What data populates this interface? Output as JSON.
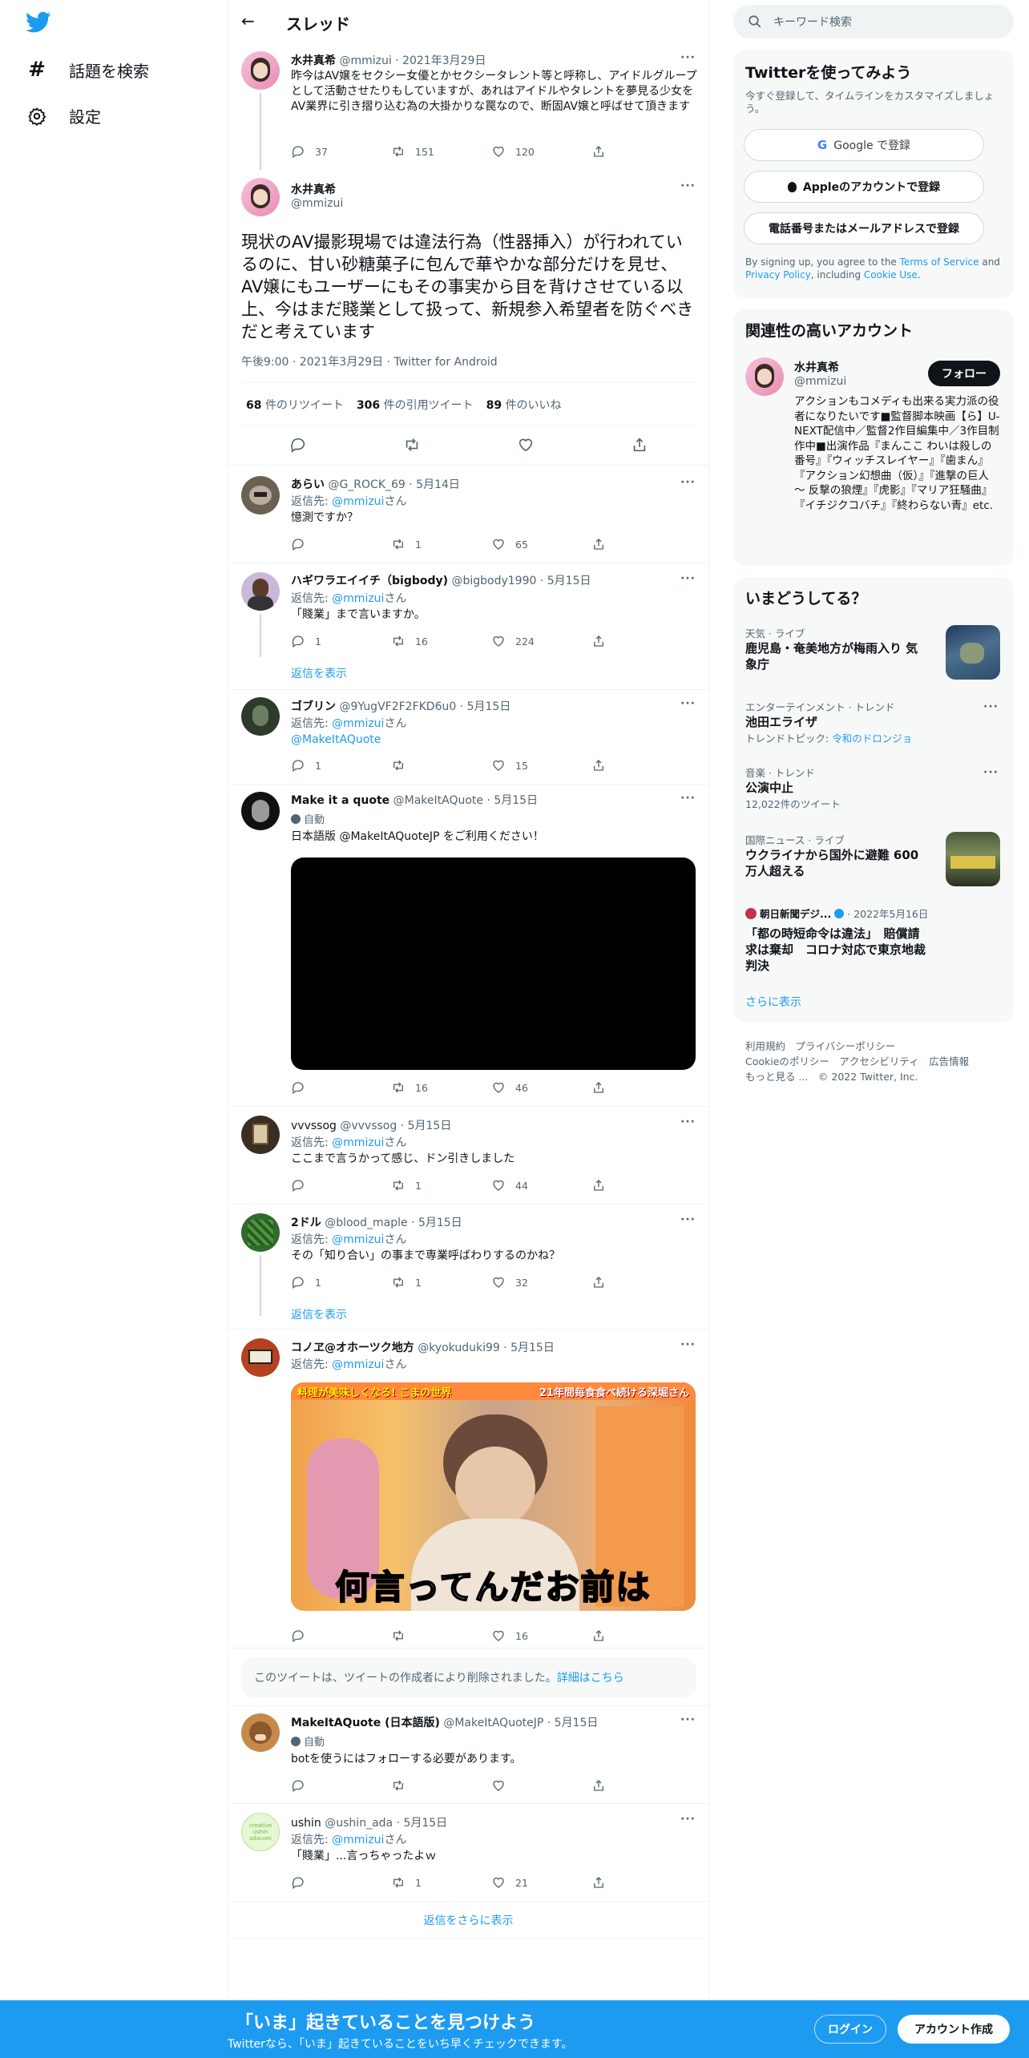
{
  "nav": {
    "items": [
      {
        "label": "話題を検索",
        "icon": "hashtag-icon"
      },
      {
        "label": "設定",
        "icon": "gear-icon"
      }
    ]
  },
  "header": {
    "title": "スレッド"
  },
  "tweets": {
    "prev": {
      "name": "水井真希",
      "handle": "@mmizui",
      "date": "· 2021年3月29日",
      "text": "昨今はAV嬢をセクシー女優とかセクシータレント等と呼称し、アイドルグループとして活動させたりもしていますが、あれはアイドルやタレントを夢見る少女をAV業界に引き摺り込む為の大掛かりな罠なので、断固AV嬢と呼ばせて頂きます",
      "reply": "37",
      "rt": "151",
      "like": "120"
    },
    "main": {
      "name": "水井真希",
      "handle": "@mmizui",
      "text": "現状のAV撮影現場では違法行為（性器挿入）が行われているのに、甘い砂糖菓子に包んで華やかな部分だけを見せ、AV嬢にもユーザーにもその事実から目を背けさせている以上、今はまだ賤業として扱って、新規参入希望者を防ぐべきだと考えています",
      "meta": "午後9:00 · 2021年3月29日 · Twitter for Android",
      "rt_count": "68",
      "rt_label": "件のリツイート",
      "qt_count": "306",
      "qt_label": "件の引用ツイート",
      "like_count": "89",
      "like_label": "件のいいね"
    },
    "r1": {
      "name": "あらい",
      "handle": "@G_ROCK_69 · 5月14日",
      "reply_to": "返信先: ",
      "mention": "@mmizui",
      "san": "さん",
      "text": "憶測ですか？",
      "reply": "",
      "rt": "1",
      "like": "65"
    },
    "r2": {
      "name": "ハギワラエイイチ（bigbody)",
      "handle": "@bigbody1990 · 5月15日",
      "reply_to": "返信先: ",
      "mention": "@mmizui",
      "san": "さん",
      "text": "「賤業」まで言いますか。",
      "reply": "1",
      "rt": "16",
      "like": "224",
      "show": "返信を表示"
    },
    "r3": {
      "name": "ゴブリン",
      "handle": "@9YugVF2F2FKD6u0 · 5月15日",
      "reply_to": "返信先: ",
      "mention": "@mmizui",
      "san": "さん",
      "text": "@MakeItAQuote",
      "reply": "1",
      "rt": "",
      "like": "15"
    },
    "r4": {
      "name": "Make it a quote",
      "handle": "@MakeItAQuote · 5月15日",
      "auto": "自動",
      "text": "日本語版 @MakeItAQuoteJP をご利用ください！",
      "reply": "",
      "rt": "16",
      "like": "46"
    },
    "r5": {
      "name": "vvvssog",
      "handle": "@vvvssog · 5月15日",
      "reply_to": "返信先: ",
      "mention": "@mmizui",
      "san": "さん",
      "text": "ここまで言うかって感じ、ドン引きしました",
      "reply": "",
      "rt": "1",
      "like": "44"
    },
    "r6": {
      "name": "2ドル",
      "handle": "@blood_maple · 5月15日",
      "reply_to": "返信先: ",
      "mention": "@mmizui",
      "san": "さん",
      "text": "その「知り合い」の事まで専業呼ばわりするのかね？",
      "reply": "1",
      "rt": "1",
      "like": "32",
      "show": "返信を表示"
    },
    "r7": {
      "name": "コノヱ@オホーツク地方",
      "handle": "@kyokuduki99 · 5月15日",
      "reply_to": "返信先: ",
      "mention": "@mmizui",
      "san": "さん",
      "img_caption": "何言ってんだお前は",
      "img_banner_left": "料理が美味しくなる! こまの世界",
      "img_banner_right": "21年間毎食食べ続ける深堀さん",
      "reply": "",
      "rt": "",
      "like": "16"
    },
    "deleted": {
      "text": "このツイートは、ツイートの作成者により削除されました。",
      "link": "詳細はこちら"
    },
    "r8": {
      "name": "MakeItAQuote (日本語版)",
      "handle": "@MakeItAQuoteJP · 5月15日",
      "auto": "自動",
      "text": "botを使うにはフォローする必要があります。",
      "reply": "",
      "rt": "",
      "like": ""
    },
    "r9": {
      "name": "ushin",
      "handle": "@ushin_ada · 5月15日",
      "reply_to": "返信先: ",
      "mention": "@mmizui",
      "san": "さん",
      "text": "「賤業」...言っちゃったよｗ",
      "reply": "",
      "rt": "1",
      "like": "21",
      "avatar_text": "creative ushin adacom"
    },
    "more_replies": "返信をさらに表示"
  },
  "sidebar": {
    "search_placeholder": "キーワード検索",
    "signup": {
      "title": "Twitterを使ってみよう",
      "sub": "今すぐ登録して、タイムラインをカスタマイズしましょう。",
      "google": "Google で登録",
      "apple": "Appleのアカウントで登録",
      "phone": "電話番号またはメールアドレスで登録",
      "terms_pre": "By signing up, you agree to the ",
      "terms": "Terms of Service",
      "and": " and ",
      "privacy": "Privacy Policy",
      "incl": ", including ",
      "cookie": "Cookie Use",
      "dot": "."
    },
    "related": {
      "title": "関連性の高いアカウント",
      "name": "水井真希",
      "handle": "@mmizui",
      "follow": "フォロー",
      "bio": "アクションもコメディも出来る実力派の役者になりたいです■監督脚本映画【ら】U-NEXT配信中／監督2作目編集中／3作目制作中■出演作品『まんここ わいは殺しの番号』『ウィッチスレイヤー』『歯まん』『アクション幻想曲（仮）』『進撃の巨人 ～ 反撃の狼煙』『虎影』『マリア狂騒曲』『イチジクコバチ』『終わらない青』etc."
    },
    "trends": {
      "title": "いまどうしてる？",
      "items": [
        {
          "cat": "天気 · ライブ",
          "title": "鹿児島・奄美地方が梅雨入り 気象庁"
        },
        {
          "cat": "エンターテインメント · トレンド",
          "title": "池田エライザ",
          "sub_pre": "トレンドトピック: ",
          "sub_link": "令和のドロンジョ"
        },
        {
          "cat": "音楽 · トレンド",
          "title": "公演中止",
          "sub": "12,022件のツイート"
        },
        {
          "cat": "国際ニュース · ライブ",
          "title": "ウクライナから国外に避難 600万人超える"
        },
        {
          "cat_source": "朝日新聞デジ...",
          "cat_date": "· 2022年5月16日",
          "title": "「都の時短命令は違法」　賠償請求は棄却　コロナ対応で東京地裁判決"
        }
      ],
      "show_more": "さらに表示"
    },
    "footer": {
      "l1": "利用規約　プライバシーポリシー",
      "l2": "Cookieのポリシー　アクセシビリティ　広告情報",
      "l3": "もっと見る ...　© 2022 Twitter, Inc."
    }
  },
  "bottom": {
    "title": "「いま」起きていることを見つけよう",
    "sub": "Twitterなら、「いま」起きていることをいち早くチェックできます。",
    "login": "ログイン",
    "signup": "アカウント作成"
  },
  "colors": {
    "accent": "#1d9bf0",
    "text": "#0f1419",
    "gray": "#536471"
  }
}
